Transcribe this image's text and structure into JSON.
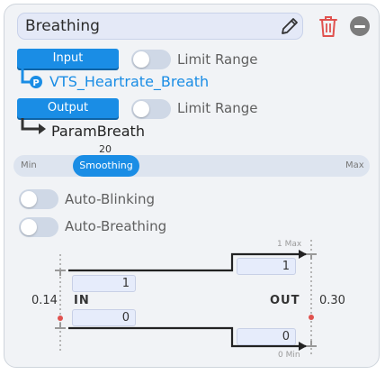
{
  "header": {
    "name_value": "Breathing",
    "icons": [
      "pencil-icon",
      "trash-icon",
      "minus-circle-icon"
    ]
  },
  "input": {
    "button_label": "Input",
    "limit_label": "Limit Range",
    "limit_on": false,
    "param": "VTS_Heartrate_Breath"
  },
  "output": {
    "button_label": "Output",
    "limit_label": "Limit Range",
    "limit_on": false,
    "param": "ParamBreath"
  },
  "smoothing": {
    "value": "20",
    "label": "Smoothing",
    "min_label": "Min",
    "max_label": "Max"
  },
  "toggles": {
    "auto_blinking": "Auto-Blinking",
    "auto_breathing": "Auto-Breathing",
    "auto_blinking_on": false,
    "auto_breathing_on": false
  },
  "mapping": {
    "in_label": "IN",
    "out_label": "OUT",
    "in_current": "0.14",
    "out_current": "0.30",
    "in_max": "1",
    "in_min": "0",
    "out_max": "1",
    "out_min": "0",
    "out_max_caption": "1 Max",
    "out_min_caption": "0 Min"
  },
  "colors": {
    "accent": "#1a8de5",
    "trash": "#e0524f",
    "indicator": "#e0524f"
  }
}
